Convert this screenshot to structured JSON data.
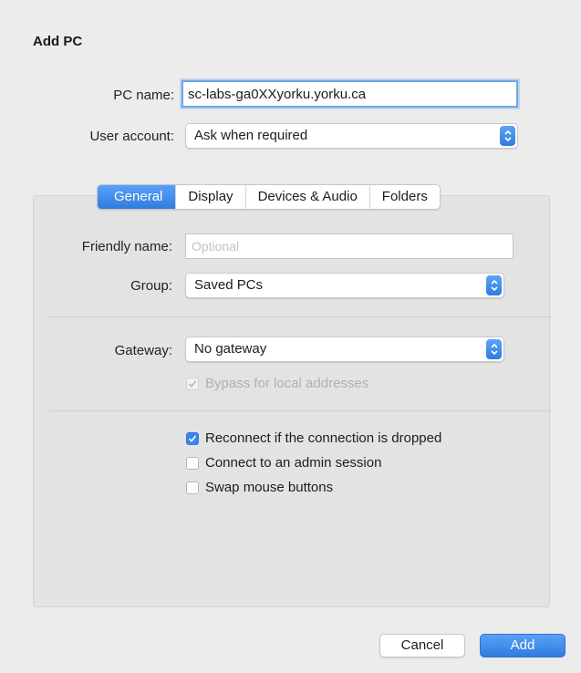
{
  "dialog": {
    "title": "Add PC"
  },
  "pc_name": {
    "label": "PC name:",
    "value": "sc-labs-ga0XXyorku.yorku.ca"
  },
  "user_account": {
    "label": "User account:",
    "value": "Ask when required"
  },
  "tabs": [
    {
      "label": "General",
      "active": true
    },
    {
      "label": "Display",
      "active": false
    },
    {
      "label": "Devices & Audio",
      "active": false
    },
    {
      "label": "Folders",
      "active": false
    }
  ],
  "general": {
    "friendly_name": {
      "label": "Friendly name:",
      "placeholder": "Optional",
      "value": ""
    },
    "group": {
      "label": "Group:",
      "value": "Saved PCs"
    },
    "gateway": {
      "label": "Gateway:",
      "value": "No gateway"
    },
    "bypass": {
      "label": "Bypass for local addresses",
      "checked": true,
      "disabled": true
    },
    "reconnect": {
      "label": "Reconnect if the connection is dropped",
      "checked": true
    },
    "admin_session": {
      "label": "Connect to an admin session",
      "checked": false
    },
    "swap_mouse": {
      "label": "Swap mouse buttons",
      "checked": false
    }
  },
  "buttons": {
    "cancel": "Cancel",
    "add": "Add"
  },
  "colors": {
    "accent": "#3b86ec",
    "background": "#ececec",
    "panel": "#e3e3e3"
  }
}
